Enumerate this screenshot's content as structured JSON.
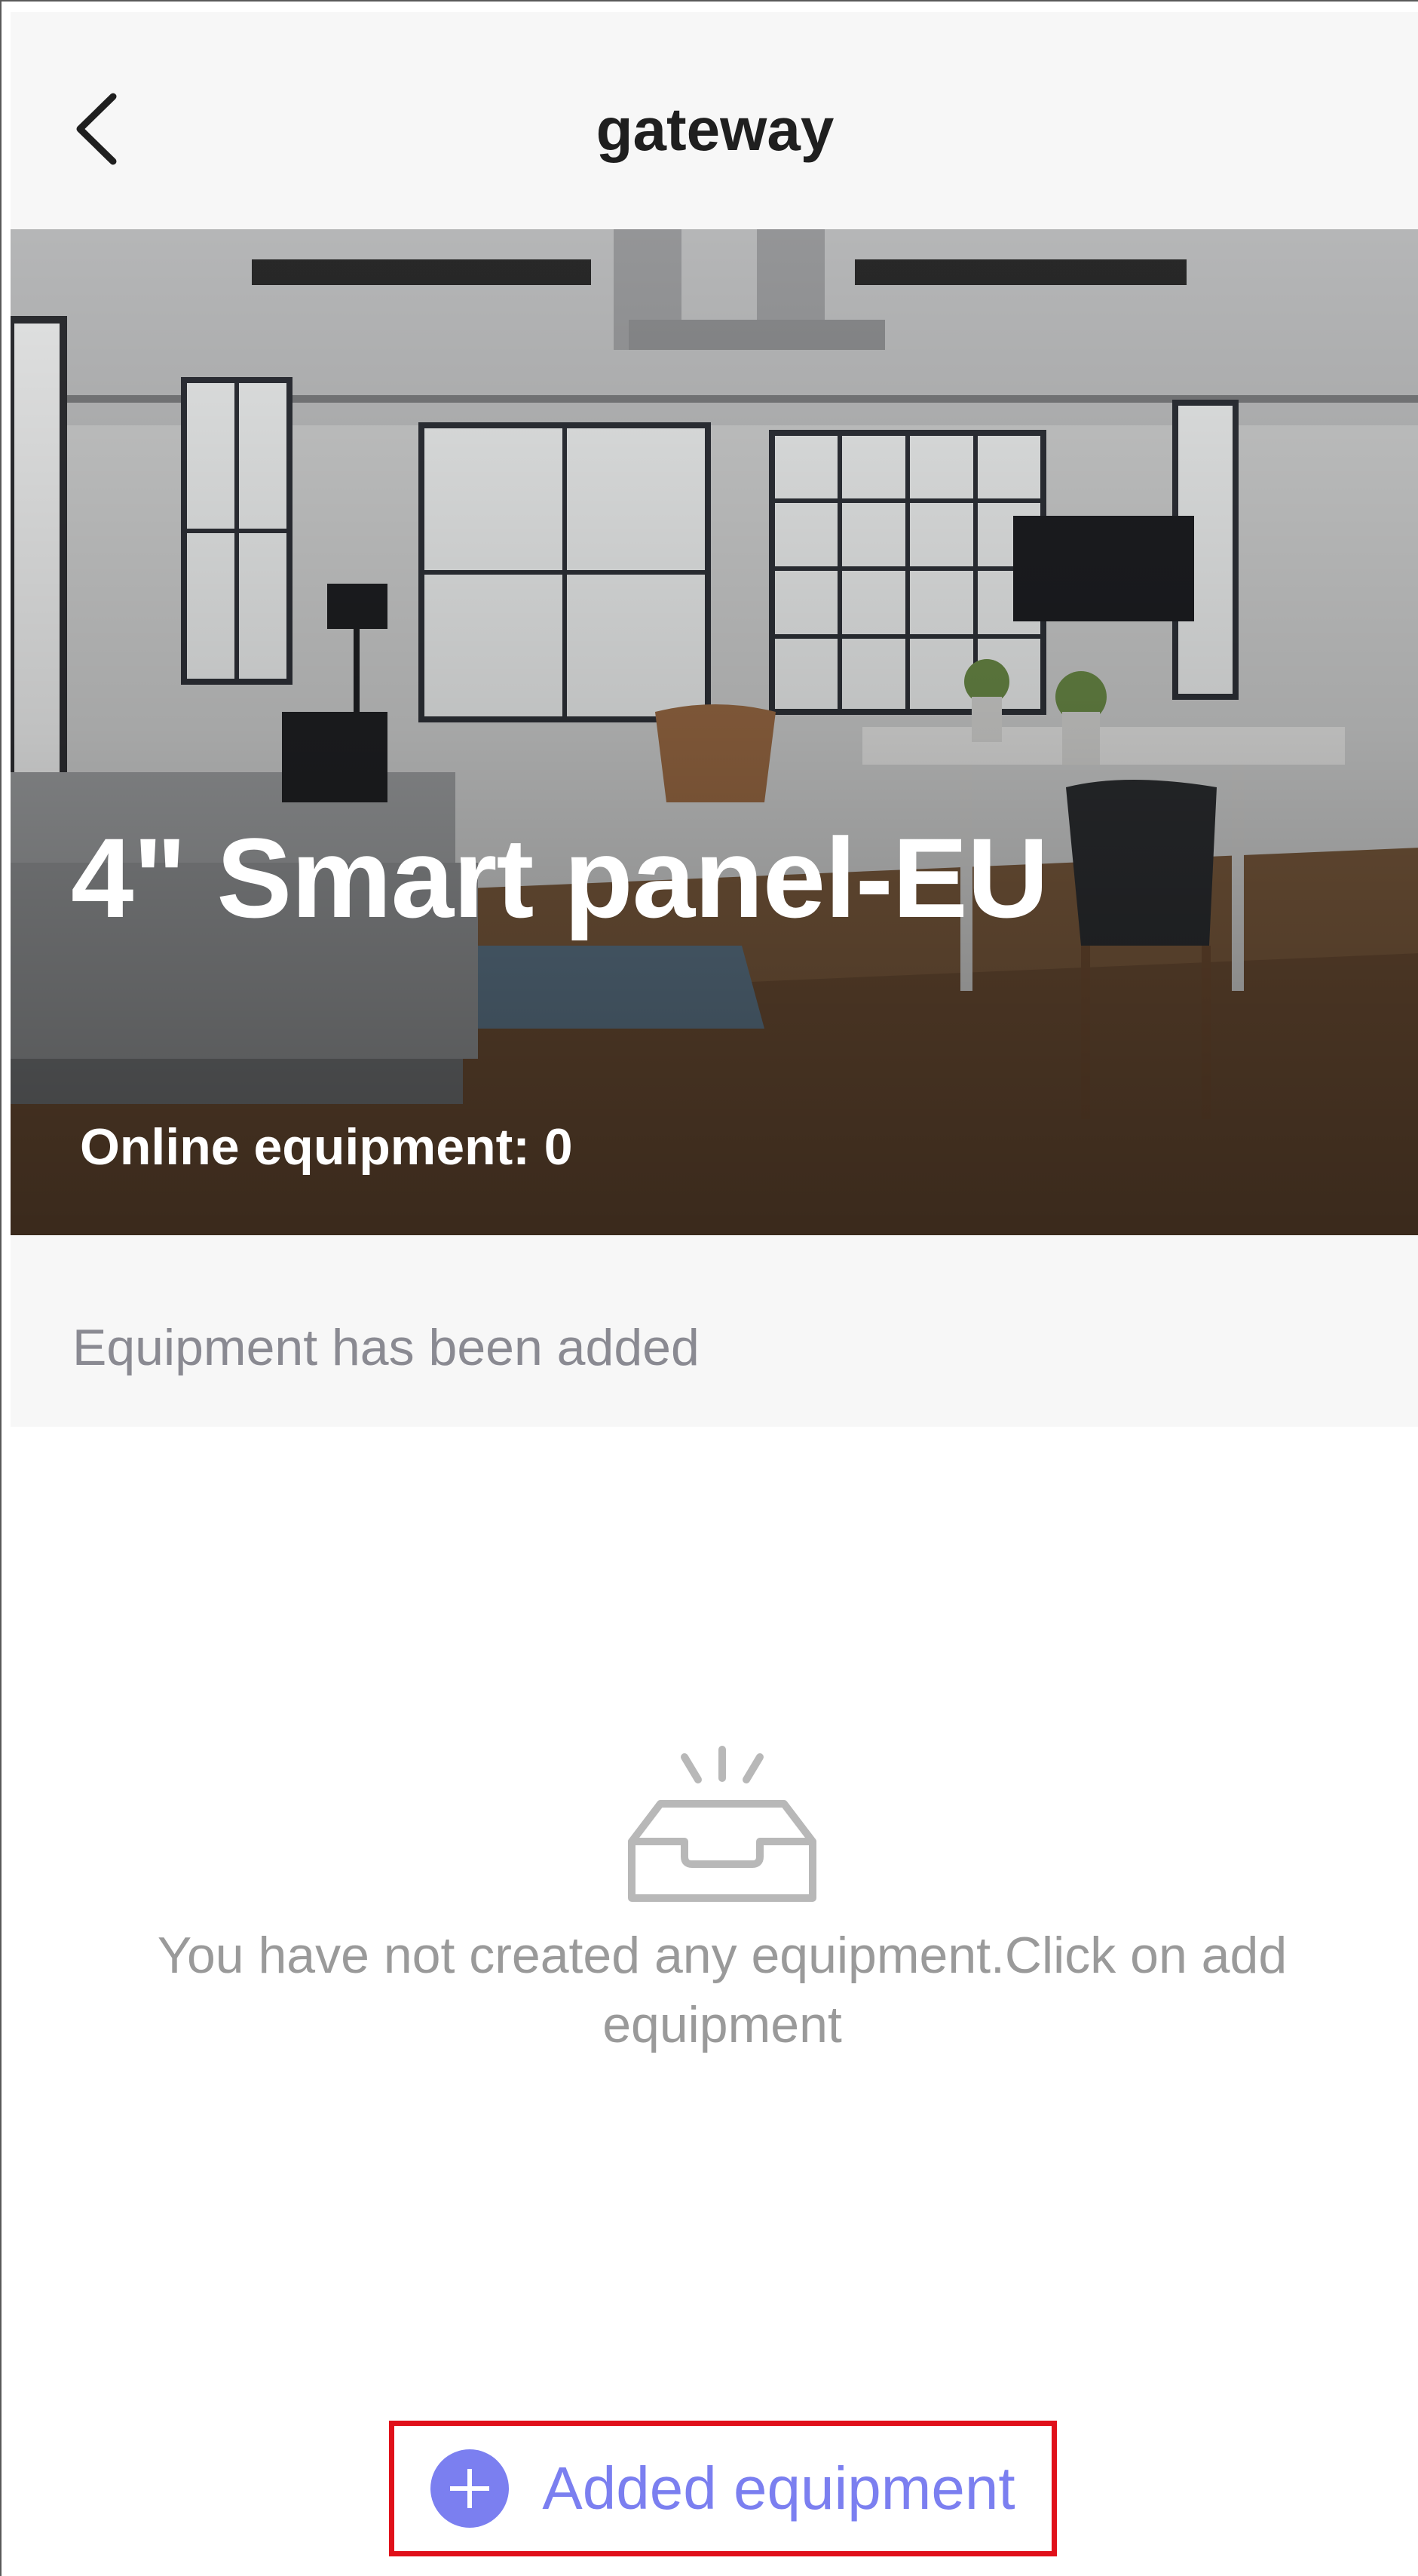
{
  "header": {
    "title": "gateway",
    "back_icon": "chevron-left-icon"
  },
  "hero": {
    "device_name": "4\" Smart panel-EU",
    "online_equipment": "Online equipment: 0"
  },
  "section": {
    "label": "Equipment has been added"
  },
  "empty_state": {
    "icon": "empty-inbox-icon",
    "message": "You have not created any equipment.Click on add equipment"
  },
  "add_button": {
    "icon": "plus-circle-icon",
    "label": "Added equipment"
  },
  "colors": {
    "accent": "#7b7ff0",
    "highlight_border": "#e0101a",
    "header_bg": "#f7f7f7",
    "title": "#1f1f1f",
    "muted_text": "#9a9a9a"
  }
}
